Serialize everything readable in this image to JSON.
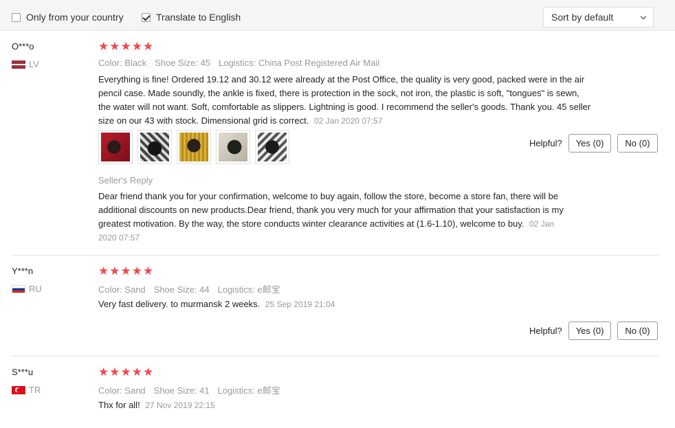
{
  "filters": {
    "only_country": {
      "label": "Only from your country",
      "checked": false
    },
    "translate": {
      "label": "Translate to English",
      "checked": true
    },
    "sort": {
      "value": "Sort by default"
    }
  },
  "colors": {
    "star": "#f0484c",
    "muted": "#999999",
    "divider": "#e6e6e6"
  },
  "reviews": [
    {
      "user": "O***o",
      "country": "LV",
      "rating": 5,
      "color": "Color: Black",
      "size": "Shoe Size: 45",
      "logistics": "Logistics: China Post Registered Air Mail",
      "text": "Everything is fine! Ordered 19.12 and 30.12 were already at the Post Office, the quality is very good, packed were in the air pencil case. Made soundly, the ankle is fixed, there is protection in the sock, not iron, the plastic is soft, \"tongues\" is sewn, the water will not want. Soft, comfortable as slippers. Lightning is good. I recommend the seller's goods. Thank you. 45 seller size on our 43 with stock. Dimensional grid is correct.",
      "date": "02 Jan 2020 07:57",
      "photos": [
        "photo-1",
        "photo-2",
        "photo-3",
        "photo-4",
        "photo-5"
      ],
      "helpful_label": "Helpful?",
      "yes": "Yes (0)",
      "no": "No (0)",
      "reply_title": "Seller's Reply",
      "reply_text": "Dear friend thank you for your confirmation, welcome to buy again, follow the store, become a store fan, there will be additional discounts on new products.Dear friend, thank you very much for your affirmation that your satisfaction is my greatest motivation. By the way, the store conducts winter clearance activities at (1.6-1.10), welcome to buy.",
      "reply_date": "02 Jan 2020 07:57"
    },
    {
      "user": "Y***n",
      "country": "RU",
      "rating": 5,
      "color": "Color: Sand",
      "size": "Shoe Size: 44",
      "logistics": "Logistics: e邮宝",
      "text": "Very fast delivery. to murmansk 2 weeks.",
      "date": "25 Sep 2019 21:04",
      "helpful_label": "Helpful?",
      "yes": "Yes (0)",
      "no": "No (0)"
    },
    {
      "user": "S***u",
      "country": "TR",
      "rating": 5,
      "color": "Color: Sand",
      "size": "Shoe Size: 41",
      "logistics": "Logistics: e邮宝",
      "text": "Thx for all!",
      "date": "27 Nov 2019 22:15"
    }
  ]
}
